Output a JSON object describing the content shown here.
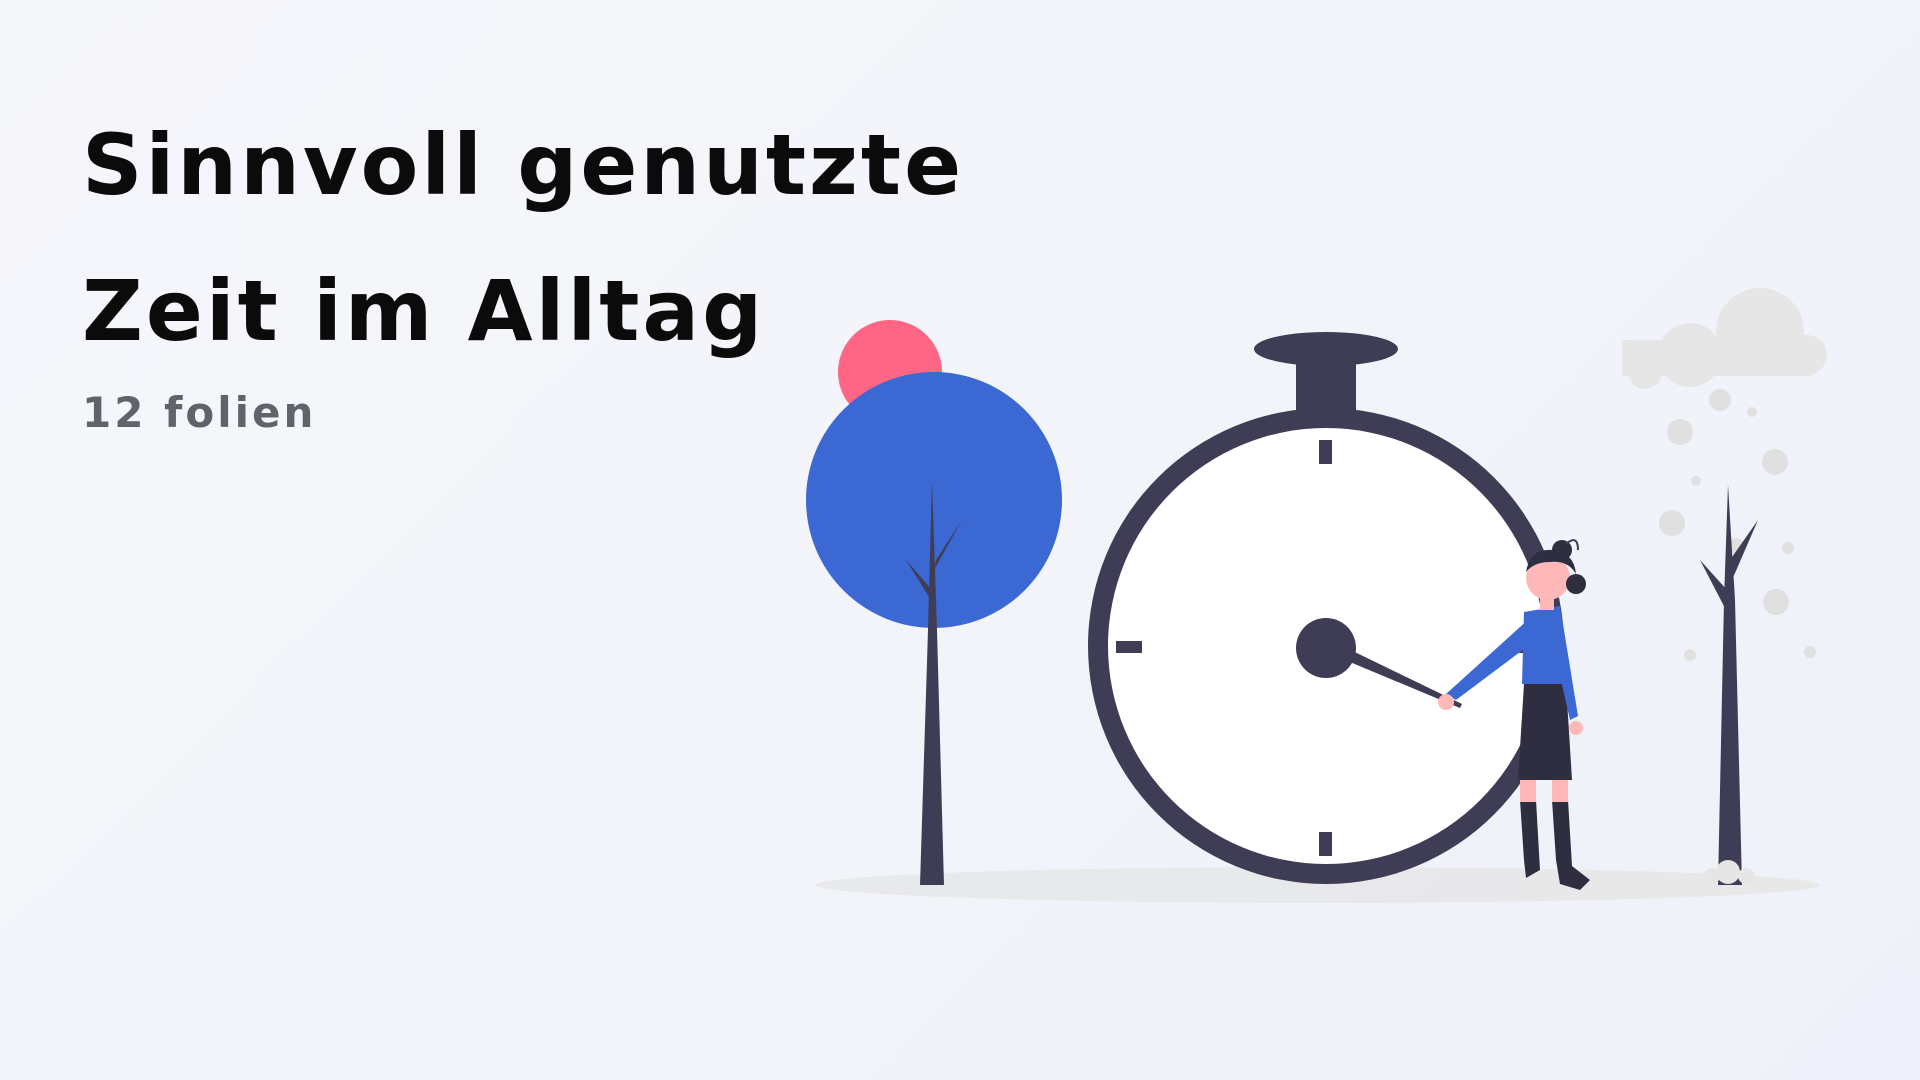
{
  "title": {
    "line1": "Sinnvoll genutzte",
    "line2": "Zeit im Alltag"
  },
  "subtitle": "12 folien",
  "colors": {
    "background": "#f3f5fa",
    "title_text": "#0b0b0c",
    "subtitle_text": "#5f636a",
    "accent_blue": "#3c68d4",
    "accent_pink": "#ff6584",
    "dark": "#3f3d56",
    "ground": "#e6e6e6"
  },
  "illustration": {
    "elements": [
      "stopwatch-icon",
      "tree-icon",
      "bare-tree-icon",
      "cloud-icon",
      "person-icon"
    ]
  }
}
